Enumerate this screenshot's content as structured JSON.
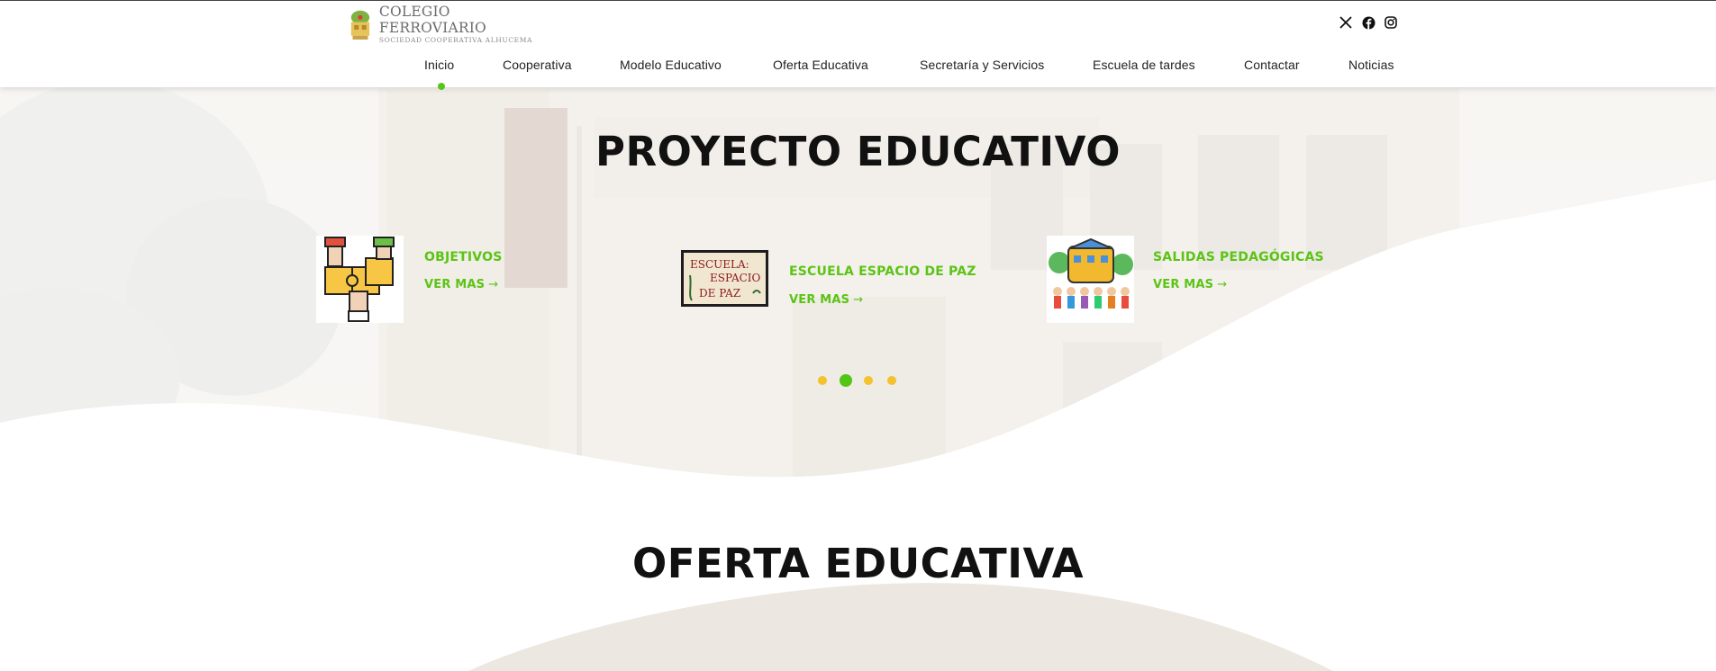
{
  "brand": {
    "title": "COLEGIO FERROVIARIO",
    "subtitle": "SOCIEDAD COOPERATIVA ALHUCEMA",
    "logo_icon": "school-crest-icon"
  },
  "social": [
    {
      "icon": "x-twitter-icon"
    },
    {
      "icon": "facebook-icon"
    },
    {
      "icon": "instagram-icon"
    }
  ],
  "nav": {
    "items": [
      {
        "label": "Inicio",
        "active": true
      },
      {
        "label": "Cooperativa"
      },
      {
        "label": "Modelo Educativo"
      },
      {
        "label": "Oferta Educativa"
      },
      {
        "label": "Secretaría y Servicios"
      },
      {
        "label": "Escuela de tardes"
      },
      {
        "label": "Contactar"
      },
      {
        "label": "Noticias"
      }
    ]
  },
  "hero": {
    "title": "PROYECTO EDUCATIVO",
    "cards": [
      {
        "title": "OBJETIVOS",
        "link": "VER MAS",
        "image": "puzzle-hands-icon"
      },
      {
        "title": "ESCUELA ESPACIO DE PAZ",
        "link": "VER MAS",
        "image": "escuela-espacio-de-paz-logo",
        "image_text": [
          "ESCUELA:",
          "ESPACIO",
          "DE PAZ"
        ]
      },
      {
        "title": "SALIDAS PEDAGÓGICAS",
        "link": "VER MAS",
        "image": "school-bus-kids-icon"
      }
    ],
    "slider": {
      "total": 4,
      "active_index": 1
    }
  },
  "section2": {
    "title": "OFERTA EDUCATIVA"
  },
  "colors": {
    "accent_green": "#5bc414",
    "dot_yellow": "#f4c22c",
    "text_dark": "#111111"
  }
}
